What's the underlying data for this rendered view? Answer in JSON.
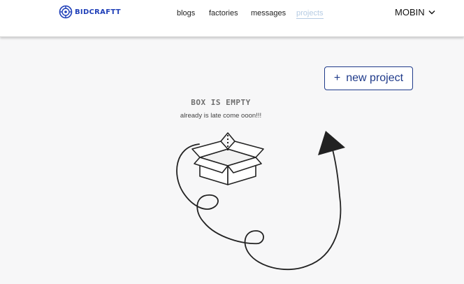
{
  "header": {
    "logo_text": "BIDCRAFTT",
    "nav": [
      {
        "label": "blogs",
        "active": false
      },
      {
        "label": "factories",
        "active": false
      },
      {
        "label": "messages",
        "active": false
      },
      {
        "label": "projects",
        "active": true
      }
    ],
    "user_name": "MOBIN"
  },
  "main": {
    "new_project_icon": "+",
    "new_project_label": "new project",
    "empty_title": "BOX IS EMPTY",
    "empty_subtitle": "already is late come ooon!!!"
  },
  "colors": {
    "brand": "#1f3fb8",
    "button_border": "#1f3a8a",
    "active_nav": "#b5cbe3",
    "page_bg": "#f7f7f8"
  },
  "icons": [
    "logo-icon",
    "chevron-down-icon",
    "plus-icon",
    "open-box-illustration",
    "paper-plane-illustration"
  ]
}
